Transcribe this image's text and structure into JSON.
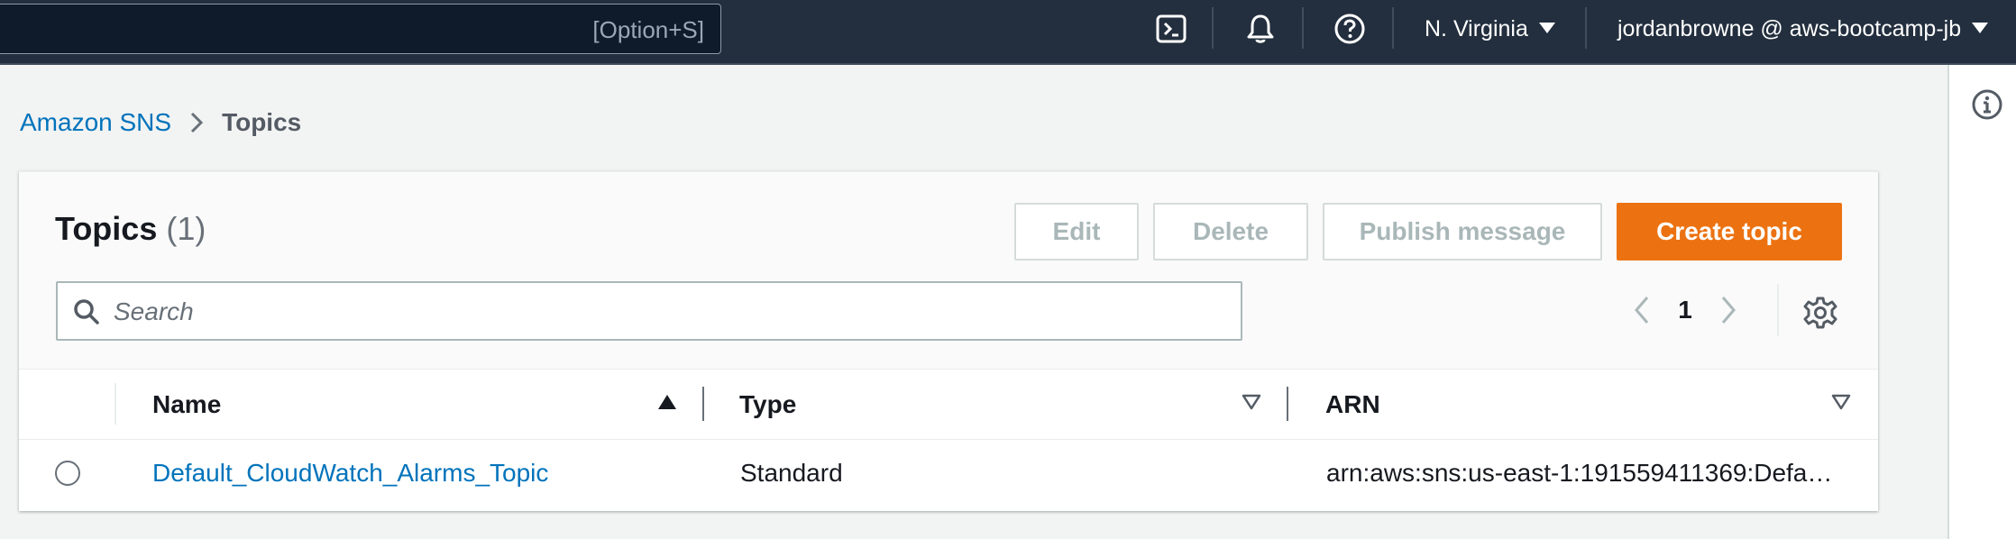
{
  "topnav": {
    "search_hint": "[Option+S]",
    "region": "N. Virginia",
    "account": "jordanbrowne @ aws-bootcamp-jb",
    "icons": [
      "cloudshell-icon",
      "bell-icon",
      "help-icon"
    ]
  },
  "breadcrumb": {
    "root": "Amazon SNS",
    "current": "Topics"
  },
  "panel": {
    "title": "Topics",
    "count": "(1)",
    "buttons": {
      "edit": "Edit",
      "delete": "Delete",
      "publish": "Publish message",
      "create": "Create topic"
    },
    "search_placeholder": "Search",
    "pagination": {
      "current_page": "1"
    }
  },
  "table": {
    "columns": [
      "Name",
      "Type",
      "ARN"
    ],
    "rows": [
      {
        "name": "Default_CloudWatch_Alarms_Topic",
        "type": "Standard",
        "arn": "arn:aws:sns:us-east-1:191559411369:Defa…"
      }
    ]
  },
  "colors": {
    "nav_bg": "#232f3e",
    "link": "#0073bb",
    "primary": "#ec7211",
    "disabled_text": "#aab7b8"
  }
}
